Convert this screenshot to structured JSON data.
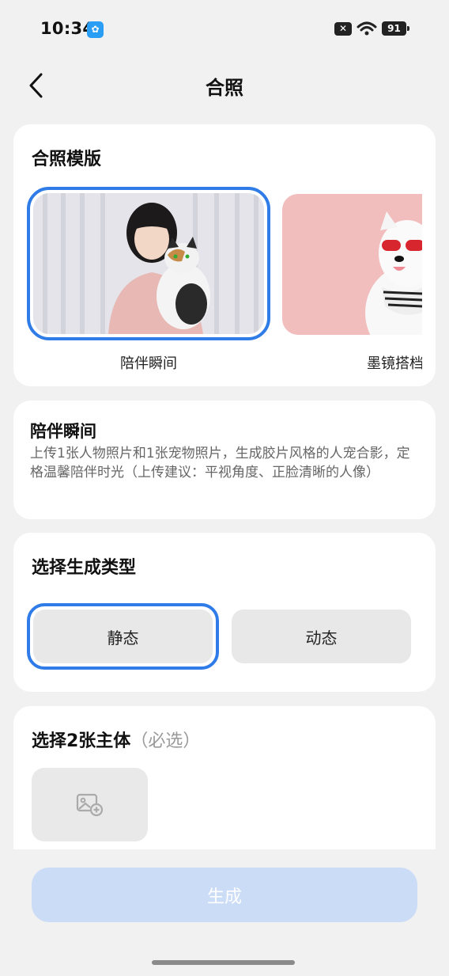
{
  "status_bar": {
    "time": "10:34",
    "battery": "91"
  },
  "header": {
    "title": "合照"
  },
  "templates": {
    "section_title": "合照模版",
    "items": [
      {
        "label": "陪伴瞬间",
        "selected": true
      },
      {
        "label": "墨镜搭档",
        "selected": false
      }
    ]
  },
  "description": {
    "title": "陪伴瞬间",
    "text": "上传1张人物照片和1张宠物照片，生成胶片风格的人宠合影，定格温馨陪伴时光（上传建议：平视角度、正脸清晰的人像）"
  },
  "gen_type": {
    "section_title": "选择生成类型",
    "options": [
      {
        "label": "静态",
        "selected": true
      },
      {
        "label": "动态",
        "selected": false
      }
    ]
  },
  "subjects": {
    "section_title": "选择2张主体",
    "hint": "（必选）"
  },
  "generate_button": {
    "label": "生成"
  },
  "colors": {
    "accent": "#2f7ce8",
    "button_disabled": "#cbdcf6",
    "background": "#f1f1f1"
  }
}
